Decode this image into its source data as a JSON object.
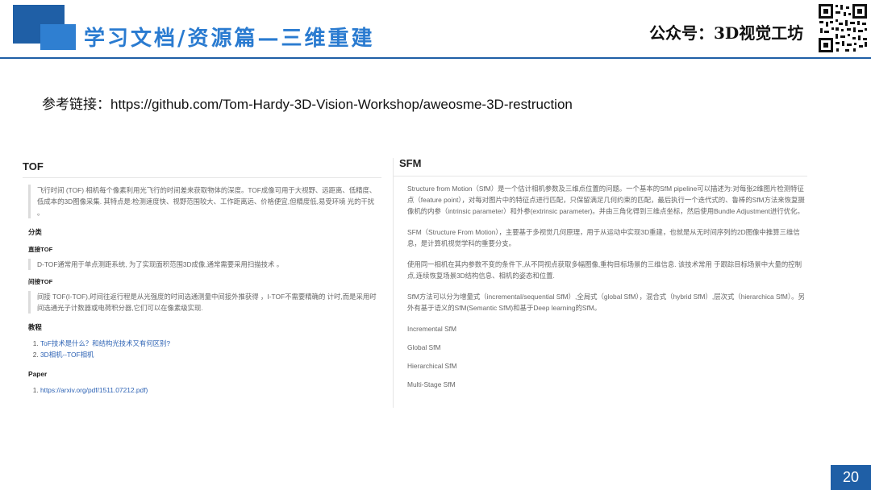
{
  "header": {
    "title": "学习文档/资源篇—三维重建",
    "account": "公众号：3D视觉工坊",
    "brand_color": "#1f5fa6"
  },
  "reference": {
    "label": "参考链接：",
    "url": "https://github.com/Tom-Hardy-3D-Vision-Workshop/aweosme-3D-restruction"
  },
  "tof": {
    "title": "TOF",
    "intro": "飞行时间 (TOF) 相机每个像素利用光飞行的时间差来获取物体的深度。TOF成像可用于大视野、远距离、低精度、低成本的3D图像采集. 其特点是:检测速度快、视野范围较大、工作距离远、价格便宜,但精度低,易受环境 光的干扰 。",
    "classify_heading": "分类",
    "direct_heading": "直接TOF",
    "direct_text": "D-TOF通常用于单点测距系统, 为了实现面积范围3D成像,通常需要采用扫描技术 。",
    "indirect_heading": "间接TOF",
    "indirect_text": "间接 TOF(I-TOF),时间往返行程是从光强度的时间选通测量中间接外推获得 ，I-TOF不需要精确的 计时,而是采用时间选通光子计数器或电荷积分器,它们可以在像素级实现.",
    "tutorial_heading": "教程",
    "tutorials": [
      "ToF技术是什么？和结构光技术又有何区别?",
      "3D相机--TOF相机"
    ],
    "paper_heading": "Paper",
    "papers": [
      "https://arxiv.org/pdf/1511.07212.pdf)"
    ]
  },
  "sfm": {
    "title": "SFM",
    "p1": "Structure from Motion（SfM）是一个估计相机参数及三维点位置的问题。一个基本的SfM pipeline可以描述为:对每张2维图片检测特征点（feature point），对每对图片中的特征点进行匹配，只保留满足几何约束的匹配，最后执行一个迭代式的、鲁棒的SfM方法来恢复摄像机的内参（intrinsic parameter）和外参(extrinsic parameter)。并由三角化得到三维点坐标，然后使用Bundle Adjustment进行优化。",
    "p2": "SFM（Structure From Motion），主要基于多视觉几何原理，用于从运动中实现3D重建，也就是从无时间序列的2D图像中推算三维信息，是计算机视觉学科的重要分支。",
    "p3": "使用同一相机在其内参数不变的条件下,从不同视点获取多幅图像,重构目标场景的三维信息. 该技术常用 于跟踪目标场景中大量的控制点,连续恢复场景3D结构信息、相机的姿态和位置.",
    "p4": "SfM方法可以分为增量式（incremental/sequential SfM）,全局式（global SfM），混合式（hybrid SfM）,层次式（hierarchica SfM）。另外有基于语义的SfM(Semantic SfM)和基于Deep learning的SfM。",
    "items": [
      "Incremental SfM",
      "Global SfM",
      "Hierarchical SfM",
      "Multi-Stage SfM"
    ]
  },
  "page_number": "20"
}
